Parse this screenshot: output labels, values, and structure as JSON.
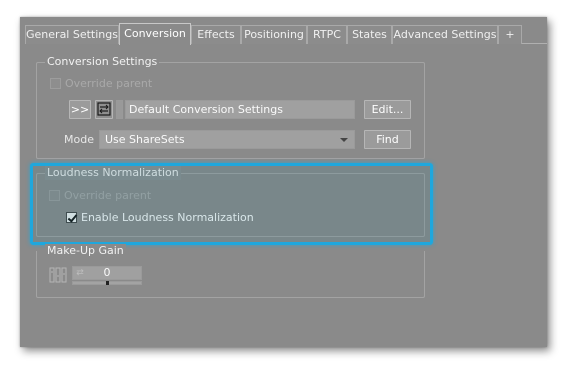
{
  "tabs": [
    {
      "label": "General Settings",
      "active": false
    },
    {
      "label": "Conversion",
      "active": true
    },
    {
      "label": "Effects",
      "active": false
    },
    {
      "label": "Positioning",
      "active": false
    },
    {
      "label": "RTPC",
      "active": false
    },
    {
      "label": "States",
      "active": false
    },
    {
      "label": "Advanced Settings",
      "active": false
    },
    {
      "label": "+",
      "active": false
    }
  ],
  "conversion_settings": {
    "title": "Conversion Settings",
    "override_parent_label": "Override parent",
    "override_parent_checked": false,
    "arrow_button_label": ">>",
    "shareset_value": "Default Conversion Settings",
    "edit_button_label": "Edit...",
    "mode_label": "Mode",
    "mode_value": "Use ShareSets",
    "find_button_label": "Find"
  },
  "loudness_normalization": {
    "title": "Loudness Normalization",
    "override_parent_label": "Override parent",
    "override_parent_checked": false,
    "enable_label": "Enable Loudness Normalization",
    "enable_checked": true
  },
  "makeup_gain": {
    "title": "Make-Up Gain",
    "value": "0"
  },
  "colors": {
    "window_bg": "#8a8a8a",
    "highlight": "#1fa7dd"
  }
}
